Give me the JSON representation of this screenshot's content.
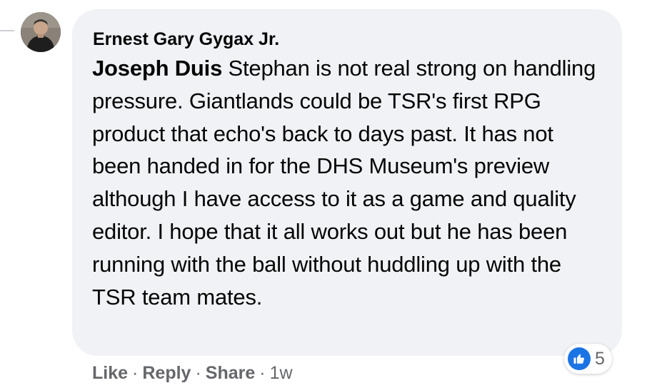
{
  "comment": {
    "author": "Ernest Gary Gygax Jr.",
    "mention": "Joseph Duis",
    "text": " Stephan is not real strong on handling pressure. Giantlands could be TSR's first RPG product that echo's back to days past. It has not been handed in for the DHS Museum's preview although I have access to it as a game and quality editor. I hope that it all works out but he has been running with the ball without huddling up with the TSR team mates.",
    "reaction_icon": "like-icon",
    "reaction_count": "5"
  },
  "actions": {
    "like": "Like",
    "reply": "Reply",
    "share": "Share",
    "separator": "·",
    "timestamp": "1w"
  },
  "colors": {
    "bubble": "#f0f2f5",
    "text": "#050505",
    "secondary_text": "#65676b",
    "like_blue": "#1b74e4"
  }
}
